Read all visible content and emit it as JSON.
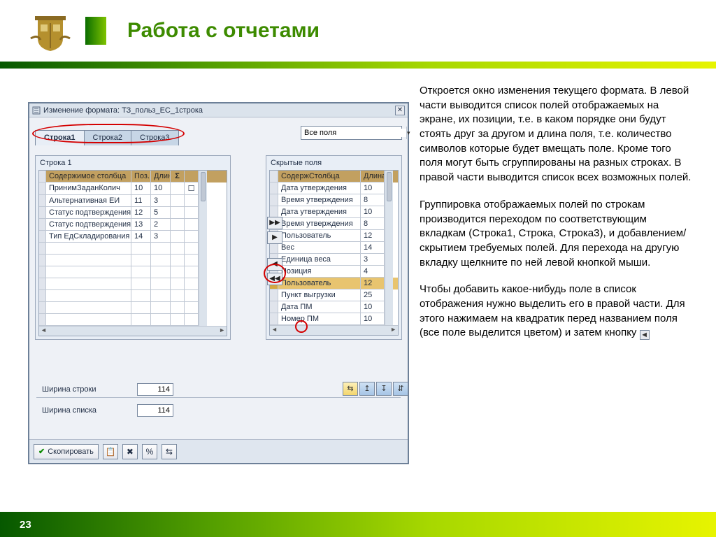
{
  "slide": {
    "title": "Работа с отчетами",
    "page": "23"
  },
  "desc": {
    "p1": "Откроется окно изменения текущего формата. В левой части выводится список полей отображаемых на экране, их позиции, т.е. в каком порядке они будут стоять друг за другом и длина поля, т.е. количество символов которые будет вмещать поле. Кроме того поля могут быть сгруппированы на разных строках. В правой части выводится список всех возможных полей.",
    "p2": "Группировка отображаемых полей по строкам производится переходом по соответствующим вкладкам (Строка1, Строка, Строка3), и добавлением/скрытием требуемых полей. Для перехода на другую вкладку щелкните по ней левой кнопкой мыши.",
    "p3_a": "Чтобы добавить какое-нибудь поле в список отображения нужно выделить его в правой части. Для этого нажимаем на квадратик перед названием поля (все поле выделится цветом) и затем кнопку ",
    "p3_btn": "◄"
  },
  "win": {
    "title": "Изменение формата: ТЗ_польз_ЕС_1строка",
    "close": "✕",
    "tabs": [
      "Строка1",
      "Строка2",
      "Строка3"
    ],
    "allfields_value": "Все поля",
    "left_panel_title": "Строка 1",
    "left_headers": {
      "name": "Содержимое столбца",
      "pos": "Поз.",
      "len": "Длина",
      "sigma": "Σ"
    },
    "left_rows": [
      {
        "name": "ПринимЗаданКолич",
        "pos": "10",
        "len": "10"
      },
      {
        "name": "Альтернативная ЕИ",
        "pos": "11",
        "len": "3"
      },
      {
        "name": "Статус подтверждения Отгр",
        "pos": "12",
        "len": "5"
      },
      {
        "name": "Статус подтверждения",
        "pos": "13",
        "len": "2"
      },
      {
        "name": "Тип ЕдСкладирования",
        "pos": "14",
        "len": "3"
      }
    ],
    "left_empty_count": 7,
    "right_panel_title": "Скрытые поля",
    "right_headers": {
      "name": "СодержСтолбца",
      "len": "Длина"
    },
    "right_rows": [
      {
        "name": "Дата утверждения",
        "len": "10"
      },
      {
        "name": "Время утверждения",
        "len": "8"
      },
      {
        "name": "Дата утверждения",
        "len": "10"
      },
      {
        "name": "Время утверждения",
        "len": "8"
      },
      {
        "name": "Пользователь",
        "len": "12"
      },
      {
        "name": "Вес",
        "len": "14"
      },
      {
        "name": "Единица веса",
        "len": "3"
      },
      {
        "name": "Позиция",
        "len": "4"
      },
      {
        "name": "Пользователь",
        "len": "12",
        "selected": true
      },
      {
        "name": "Пункт выгрузки",
        "len": "25"
      },
      {
        "name": "Дата ПМ",
        "len": "10"
      },
      {
        "name": "Номер ПМ",
        "len": "10"
      }
    ],
    "shuttle": {
      "add_all": "▶▶",
      "add": "▶",
      "remove": "◀",
      "remove_all": "◀◀"
    },
    "width_row_label": "Ширина строки",
    "width_list_label": "Ширина списка",
    "width_row_value": "114",
    "width_list_value": "114",
    "right_icons": [
      "⇆",
      "↥",
      "↧",
      "⇵"
    ],
    "copy_btn": "Скопировать",
    "bottom_icons": [
      "📋",
      "✖",
      "%",
      "⇆"
    ]
  }
}
